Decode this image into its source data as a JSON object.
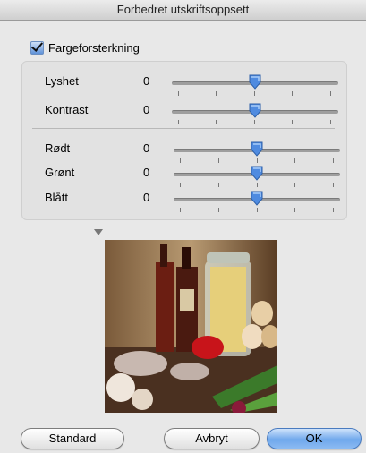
{
  "window": {
    "title": "Forbedret utskriftsoppsett"
  },
  "enhancement": {
    "label": "Fargeforsterkning",
    "checked": true
  },
  "sliders": [
    {
      "label": "Lyshet",
      "value": "0"
    },
    {
      "label": "Kontrast",
      "value": "0"
    },
    {
      "label": "Rødt",
      "value": "0"
    },
    {
      "label": "Grønt",
      "value": "0"
    },
    {
      "label": "Blått",
      "value": "0"
    }
  ],
  "buttons": {
    "standard": "Standard",
    "cancel": "Avbryt",
    "ok": "OK"
  },
  "colors": {
    "accent": "#5f92d9",
    "thumb": "#4f8be0"
  }
}
